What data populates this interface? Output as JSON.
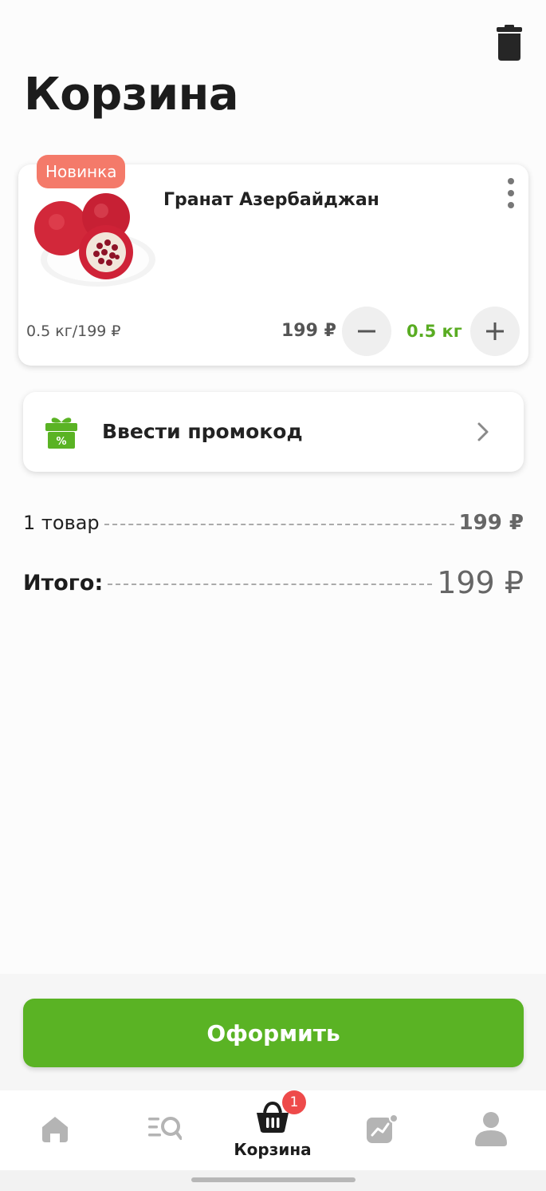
{
  "header": {
    "title": "Корзина",
    "trash_icon": "trash-icon"
  },
  "cart_item": {
    "badge": "Новинка",
    "name": "Гранат Азербайджан",
    "unit_price": "0.5 кг/199 ₽",
    "price": "199 ₽",
    "quantity": "0.5 кг",
    "image": "pomegranate-image"
  },
  "promo": {
    "label": "Ввести промокод",
    "icon": "gift-percent-icon"
  },
  "summary": {
    "items_label": "1 товар",
    "items_value": "199 ₽",
    "total_label": "Итого:",
    "total_value": "199 ₽"
  },
  "checkout": {
    "label": "Оформить"
  },
  "bottom_nav": {
    "items": [
      {
        "icon": "home-icon",
        "label": ""
      },
      {
        "icon": "catalog-search-icon",
        "label": ""
      },
      {
        "icon": "basket-icon",
        "label": "Корзина",
        "badge": "1"
      },
      {
        "icon": "stats-icon",
        "label": ""
      },
      {
        "icon": "profile-icon",
        "label": ""
      }
    ],
    "active": "Корзина"
  },
  "colors": {
    "accent_green": "#5ab324",
    "badge_new": "#f47a6a",
    "cart_badge": "#ee4a4a",
    "qty_green": "#59ac22"
  }
}
